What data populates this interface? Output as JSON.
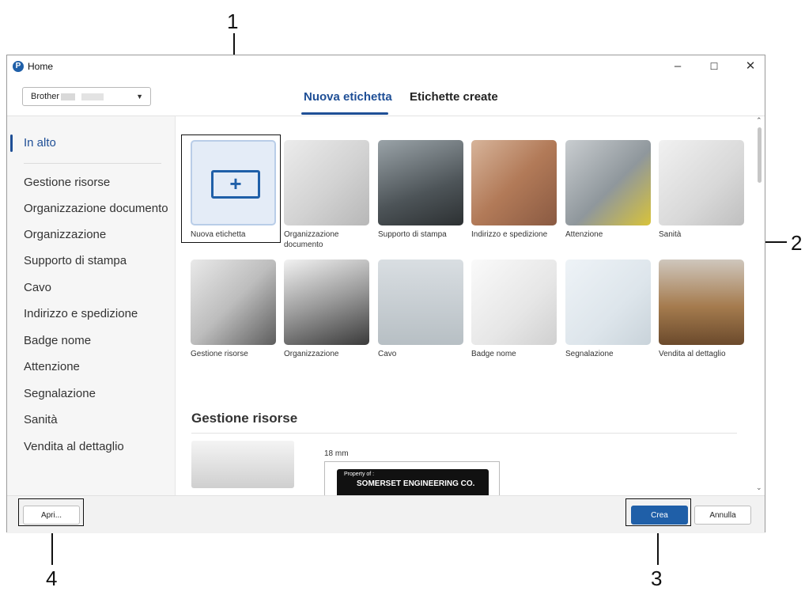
{
  "callouts": {
    "n1": "1",
    "n2": "2",
    "n3": "3",
    "n4": "4"
  },
  "window": {
    "title": "Home",
    "minimize_icon": "minimize-icon",
    "maximize_icon": "maximize-icon",
    "close_icon": "close-icon"
  },
  "printer": {
    "label": "Brother"
  },
  "tabs": [
    {
      "label": "Nuova etichetta",
      "active": true
    },
    {
      "label": "Etichette create",
      "active": false
    }
  ],
  "sidebar": {
    "items": [
      {
        "label": "In alto",
        "active": true
      },
      {
        "label": "Gestione risorse"
      },
      {
        "label": "Organizzazione documento"
      },
      {
        "label": "Organizzazione"
      },
      {
        "label": "Supporto di stampa"
      },
      {
        "label": "Cavo"
      },
      {
        "label": "Indirizzo e spedizione"
      },
      {
        "label": "Badge nome"
      },
      {
        "label": "Attenzione"
      },
      {
        "label": "Segnalazione"
      },
      {
        "label": "Sanità"
      },
      {
        "label": "Vendita al dettaglio"
      }
    ]
  },
  "tiles": [
    {
      "label": "Nuova etichetta",
      "icon": "new-label-icon"
    },
    {
      "label": "Organizzazione documento"
    },
    {
      "label": "Supporto di stampa"
    },
    {
      "label": "Indirizzo e spedizione"
    },
    {
      "label": "Attenzione"
    },
    {
      "label": "Sanità"
    },
    {
      "label": "Gestione risorse"
    },
    {
      "label": "Organizzazione"
    },
    {
      "label": "Cavo"
    },
    {
      "label": "Badge nome"
    },
    {
      "label": "Segnalazione"
    },
    {
      "label": "Vendita al dettaglio"
    }
  ],
  "section": {
    "title": "Gestione risorse",
    "size": "18 mm",
    "label_line1": "Property of :",
    "label_line2": "SOMERSET ENGINEERING CO."
  },
  "footer": {
    "open_label": "Apri...",
    "create_label": "Crea",
    "cancel_label": "Annulla"
  },
  "colors": {
    "accent": "#1f5fa8",
    "active_text": "#1f4f96"
  }
}
